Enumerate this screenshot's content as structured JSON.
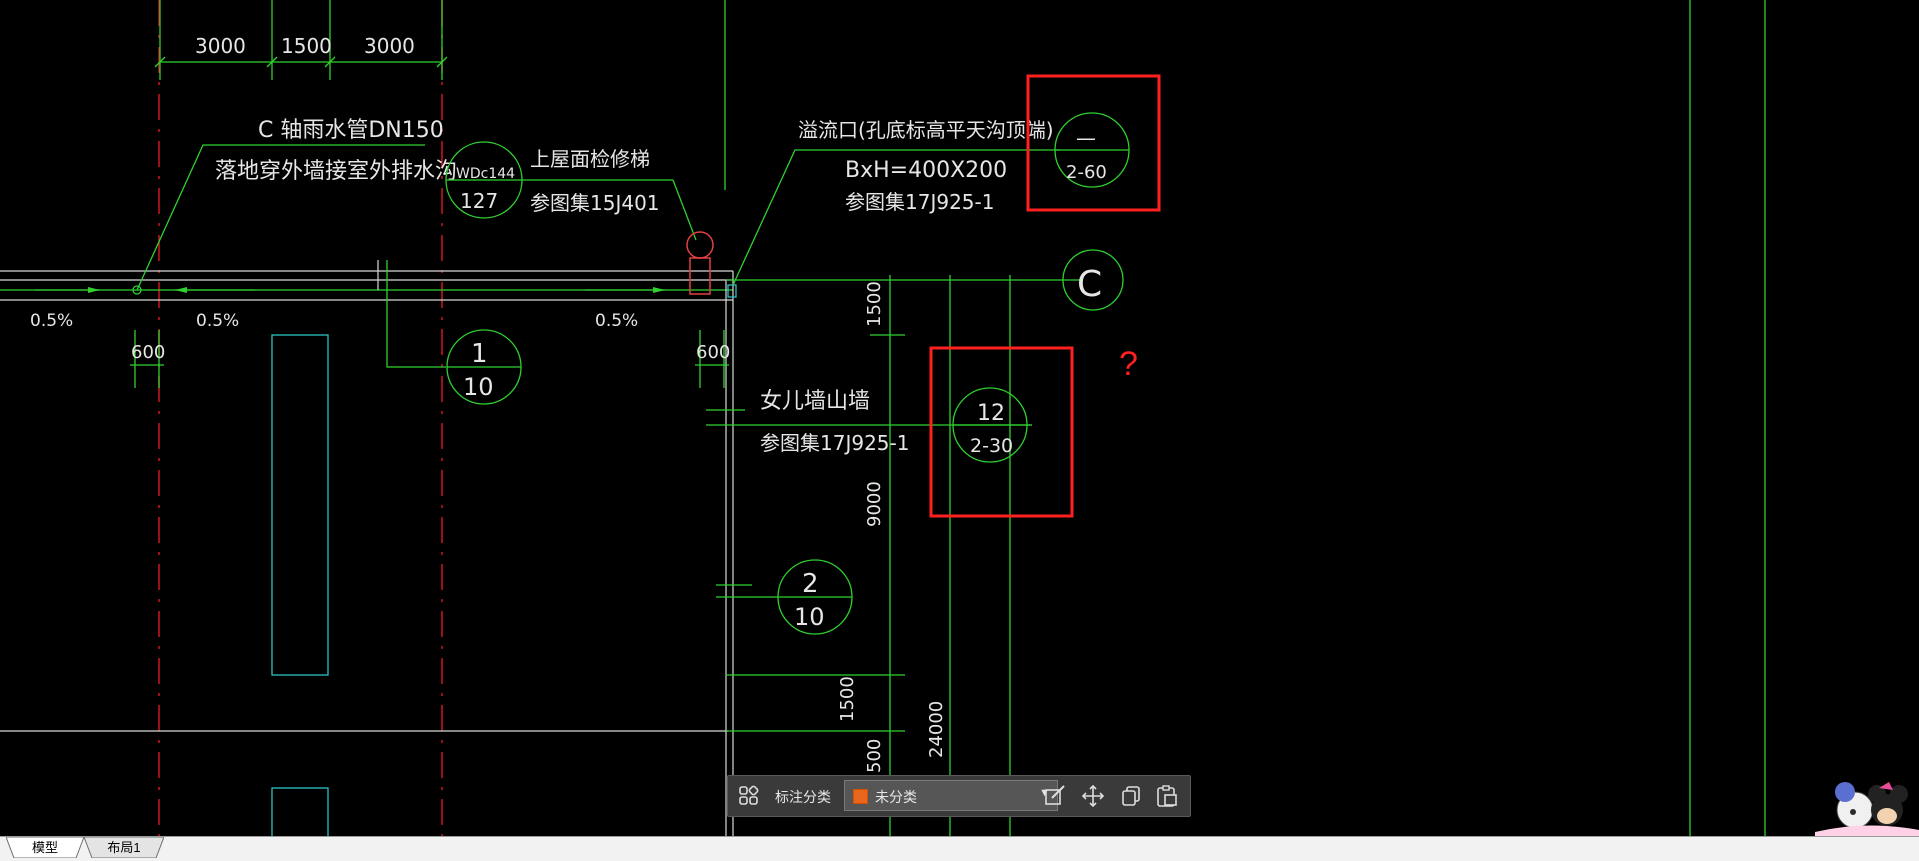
{
  "drawing": {
    "dimensions_top": [
      "3000",
      "1500",
      "3000"
    ],
    "rain_pipe_label": "C 轴雨水管DN150",
    "drain_label": "落地穿外墙接室外排水沟",
    "ladder_symbol": {
      "top": "WDc144",
      "bottom": "127"
    },
    "ladder_label": "上屋面检修梯",
    "ladder_ref": "参图集15J401",
    "overflow_label": "溢流口(孔底标高平天沟顶端)",
    "overflow_size": "BxH=400X200",
    "overflow_ref": "参图集17J925-1",
    "callout_overflow": {
      "top": "—",
      "bottom": "2-60"
    },
    "axis_bubble": "C",
    "slopes": [
      "0.5%",
      "0.5%",
      "0.5%"
    ],
    "dim_600": [
      "600",
      "600"
    ],
    "section_1": {
      "top": "1",
      "bottom": "10"
    },
    "parapet_label": "女儿墙山墙",
    "parapet_ref": "参图集17J925-1",
    "callout_parapet": {
      "top": "12",
      "bottom": "2-30"
    },
    "question_mark": "?",
    "section_2": {
      "top": "2",
      "bottom": "10"
    },
    "vertical_dims": [
      "1500",
      "9000",
      "1500",
      "24000",
      "500"
    ]
  },
  "toolbar": {
    "label": "标注分类",
    "select_value": "未分类",
    "swatch_color": "#e8661b",
    "icons": [
      "grid-icon",
      "edit-icon",
      "move-icon",
      "copy-icon",
      "paste-icon"
    ]
  },
  "tabs": [
    {
      "label": "模型",
      "active": true
    },
    {
      "label": "布局1",
      "active": false
    }
  ],
  "colors": {
    "cad_line": "#2fd12f",
    "axis": "#c0161e",
    "highlight": "#ff2020",
    "background": "#000000"
  }
}
